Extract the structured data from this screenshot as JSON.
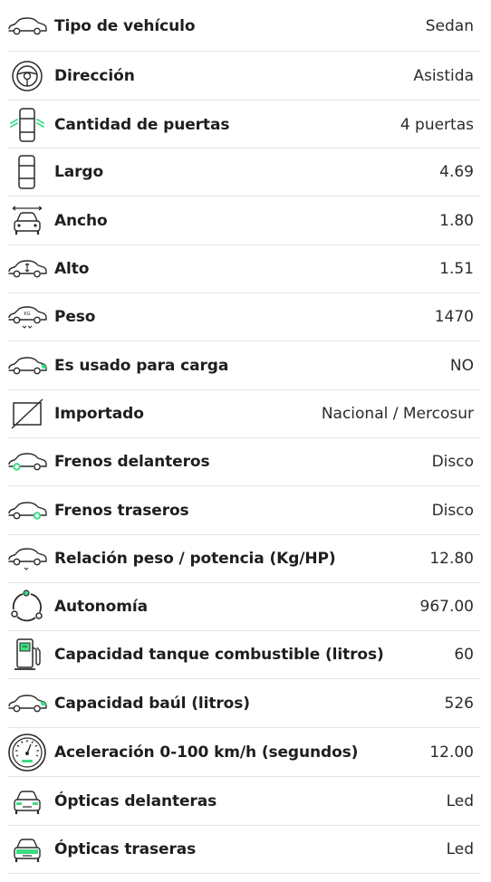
{
  "specs": [
    {
      "icon": "car-side-icon",
      "label": "Tipo de vehículo",
      "value": "Sedan"
    },
    {
      "icon": "steering-wheel-icon",
      "label": "Dirección",
      "value": "Asistida"
    },
    {
      "icon": "car-doors-icon",
      "label": "Cantidad de puertas",
      "value": "4 puertas"
    },
    {
      "icon": "car-length-icon",
      "label": "Largo",
      "value": "4.69"
    },
    {
      "icon": "car-width-icon",
      "label": "Ancho",
      "value": "1.80"
    },
    {
      "icon": "car-height-icon",
      "label": "Alto",
      "value": "1.51"
    },
    {
      "icon": "car-weight-icon",
      "label": "Peso",
      "value": "1470"
    },
    {
      "icon": "car-cargo-icon",
      "label": "Es usado para carga",
      "value": "NO"
    },
    {
      "icon": "imported-icon",
      "label": "Importado",
      "value": "Nacional / Mercosur"
    },
    {
      "icon": "front-brakes-icon",
      "label": "Frenos delanteros",
      "value": "Disco"
    },
    {
      "icon": "rear-brakes-icon",
      "label": "Frenos traseros",
      "value": "Disco"
    },
    {
      "icon": "weight-power-icon",
      "label": "Relación peso / potencia (Kg/HP)",
      "value": "12.80"
    },
    {
      "icon": "autonomy-icon",
      "label": "Autonomía",
      "value": "967.00"
    },
    {
      "icon": "fuel-tank-icon",
      "label": "Capacidad tanque combustible (litros)",
      "value": "60"
    },
    {
      "icon": "trunk-icon",
      "label": "Capacidad baúl (litros)",
      "value": "526"
    },
    {
      "icon": "speedometer-icon",
      "label": "Aceleración 0-100 km/h (segundos)",
      "value": "12.00"
    },
    {
      "icon": "front-lights-icon",
      "label": "Ópticas delanteras",
      "value": "Led"
    },
    {
      "icon": "rear-lights-icon",
      "label": "Ópticas traseras",
      "value": "Led"
    }
  ],
  "colors": {
    "accent": "#3ddc84",
    "text": "#1e1e1e",
    "divider": "#e4e4e4"
  }
}
